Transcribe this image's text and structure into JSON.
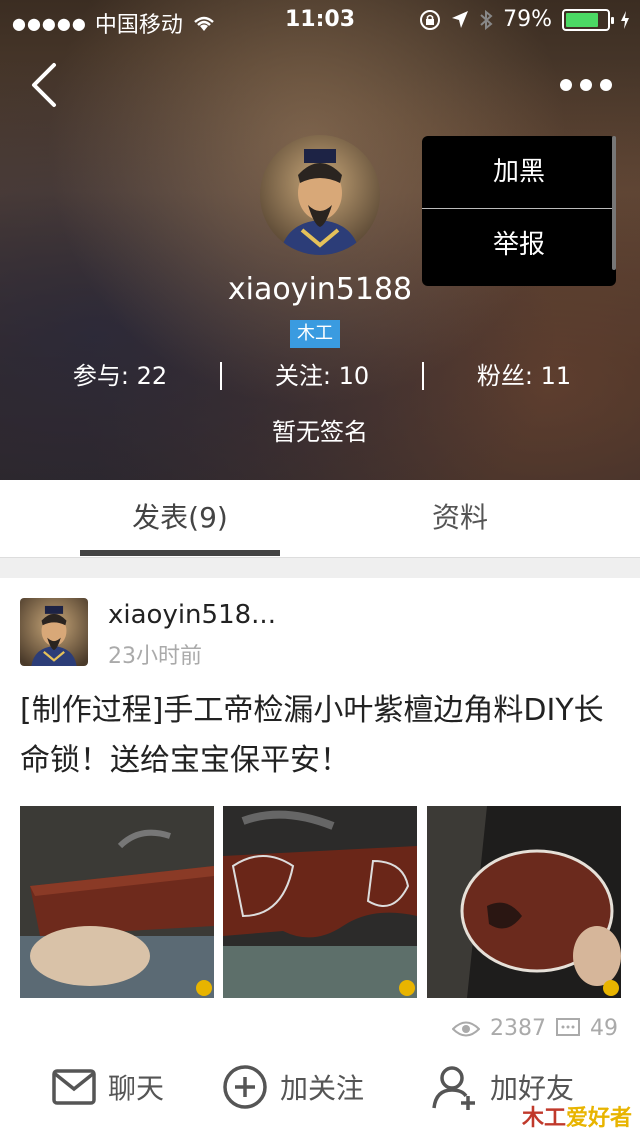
{
  "status_bar": {
    "carrier": "中国移动",
    "time": "11:03",
    "battery": "79%",
    "battery_level": 0.79
  },
  "profile": {
    "username": "xiaoyin5188",
    "tag": "木工",
    "stats": [
      {
        "label": "参与: 22"
      },
      {
        "label": "关注: 10"
      },
      {
        "label": "粉丝: 11"
      }
    ],
    "signature": "暂无签名"
  },
  "popup_menu": {
    "items": [
      "加黑",
      "举报"
    ]
  },
  "tabs": [
    {
      "label": "发表(9)",
      "active": true
    },
    {
      "label": "资料",
      "active": false
    }
  ],
  "post": {
    "author": "xiaoyin518...",
    "time": "23小时前",
    "title": "[制作过程]手工帝检漏小叶紫檀边角料DIY长命锁！送给宝宝保平安！",
    "views": "2387",
    "comments": "49"
  },
  "bottom_bar": {
    "chat": "聊天",
    "follow": "加关注",
    "add_friend": "加好友"
  },
  "watermark": {
    "part1": "木工",
    "part2": "爱好者"
  },
  "colors": {
    "tag_bg": "#3a9be0",
    "battery_green": "#4cd964"
  }
}
